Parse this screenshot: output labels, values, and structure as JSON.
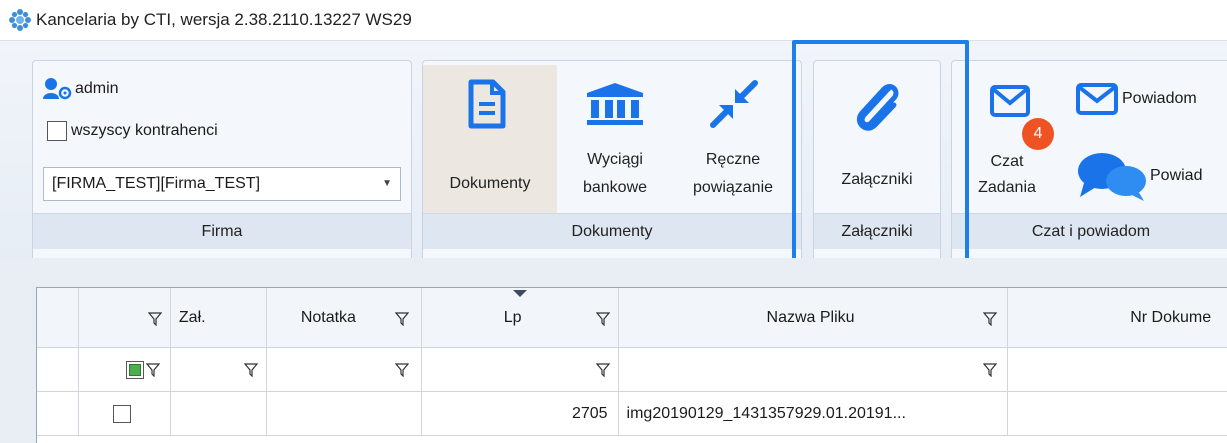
{
  "window": {
    "title": "Kancelaria by CTI, wersja  2.38.2110.13227 WS29"
  },
  "ribbon": {
    "firma": {
      "user": "admin",
      "all_contractors_label": "wszyscy kontrahenci",
      "company_value": "[FIRMA_TEST][Firma_TEST]",
      "group_label": "Firma"
    },
    "dokumenty": {
      "btn_dokumenty": "Dokumenty",
      "btn_wyciagi_line1": "Wyciągi",
      "btn_wyciagi_line2": "bankowe",
      "btn_reczne_line1": "Ręczne",
      "btn_reczne_line2": "powiązanie",
      "group_label": "Dokumenty"
    },
    "zalaczniki": {
      "btn_zalaczniki": "Załączniki",
      "group_label": "Załączniki"
    },
    "czat": {
      "btn_czat": "Czat",
      "btn_zadania": "Zadania",
      "badge_count": "4",
      "btn_powiadom1": "Powiadom",
      "btn_powiadom2": "Powiad",
      "group_label": "Czat i powiadom"
    }
  },
  "grid": {
    "columns": [
      "",
      "",
      "Zał.",
      "Notatka",
      "Lp",
      "Nazwa Pliku",
      "Nr Dokume"
    ],
    "rows": [
      {
        "lp": "2705",
        "file_name": "img20190129_1431357929.01.20191..."
      }
    ]
  },
  "colors": {
    "accent": "#1e7fe8",
    "badge": "#f05323",
    "icon_blue": "#1a73e8"
  }
}
